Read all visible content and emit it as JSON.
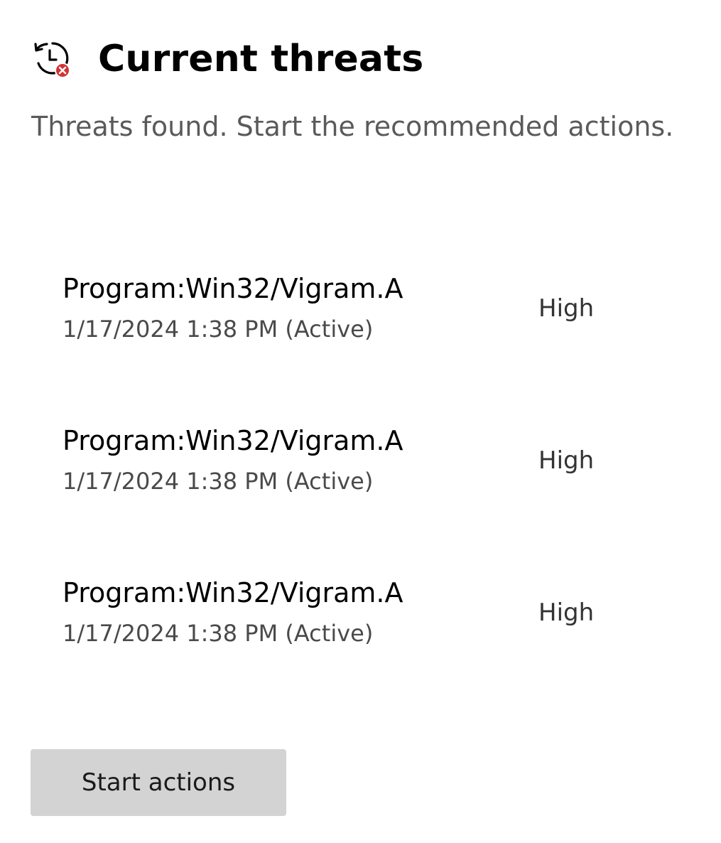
{
  "header": {
    "icon": "history-threat-icon",
    "title": "Current threats"
  },
  "subtitle": "Threats found. Start the recommended actions.",
  "threats": [
    {
      "name": "Program:Win32/Vigram.A",
      "date": "1/17/2024 1:38 PM (Active)",
      "severity": "High"
    },
    {
      "name": "Program:Win32/Vigram.A",
      "date": "1/17/2024 1:38 PM (Active)",
      "severity": "High"
    },
    {
      "name": "Program:Win32/Vigram.A",
      "date": "1/17/2024 1:38 PM (Active)",
      "severity": "High"
    }
  ],
  "actions": {
    "start_label": "Start actions"
  },
  "colors": {
    "alert_red": "#d13438",
    "button_bg": "#d3d3d3"
  }
}
